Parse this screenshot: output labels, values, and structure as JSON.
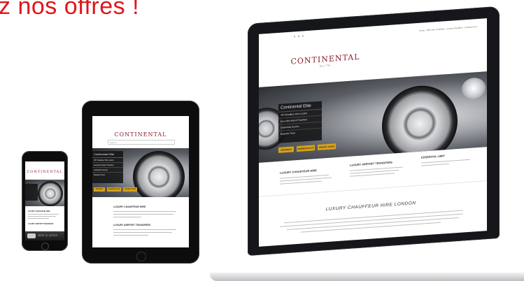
{
  "headline": "z nos offres !",
  "site": {
    "logo": "CONTINENTAL",
    "logo_sub": "ELITE",
    "menu": [
      "Continental Elite",
      "VIP Chauffeur Hire London",
      "Executive Airport Transfers",
      "Celebrities Service",
      "Bespoke Tours"
    ],
    "buttons": [
      "WEDDINGS",
      "BUSINESS ELITE",
      "PRIVATE TOURS"
    ],
    "search_placeholder": "Search",
    "features": [
      {
        "icon": "car-icon",
        "title": "LUXURY CHAUFFEUR HIRE"
      },
      {
        "icon": "plane-icon",
        "title": "LUXURY AIRPORT TRANSFERS"
      },
      {
        "icon": "phone-icon",
        "title": "ESSENTIAL LIMIT"
      }
    ],
    "section_title": "LUXURY CHAUFFEUR HIRE LONDON",
    "nav_links": [
      "Home",
      "Why Hire Chauffeur",
      "Luxury Chauffeur",
      "Contact Us"
    ],
    "phone_feature": "LUXURY CHAUFFEUR HIRE",
    "phone_feature2": "LUXURY AIRPORT TRANSFERS",
    "slide_label": "slide to unlock"
  },
  "colors": {
    "accent": "#e0141b",
    "gold": "#d6a21c",
    "logo": "#8a1c2b"
  }
}
